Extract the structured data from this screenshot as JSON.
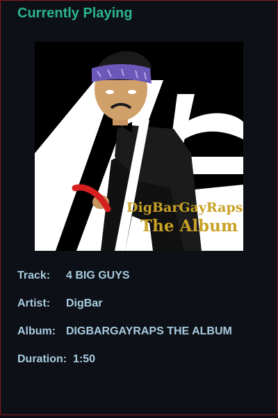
{
  "header": {
    "title": "Currently Playing"
  },
  "album_art": {
    "text_line1": "DigBarGayRaps",
    "text_line2": "The Album",
    "text_color": "#c9a227"
  },
  "track_info": {
    "track_label": "Track:",
    "track_value": "4 BIG GUYS",
    "artist_label": "Artist:",
    "artist_value": "DigBar",
    "album_label": "Album:",
    "album_value": "DIGBARGAYRAPS THE ALBUM",
    "duration_label": "Duration:",
    "duration_value": "1:50"
  },
  "colors": {
    "background": "#0d1117",
    "title": "#2bb58a",
    "meta_text": "#a9cbe0",
    "border": "#8b1a1a"
  }
}
